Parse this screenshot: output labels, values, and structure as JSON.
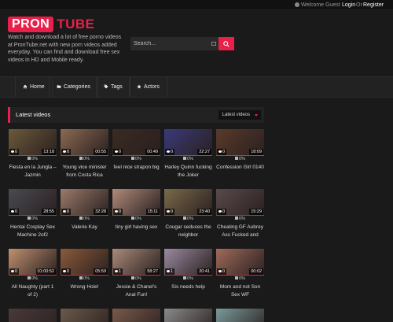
{
  "topbar": {
    "welcome": "Welcome Guest",
    "login": "Login",
    "or": "Or",
    "register": "Register"
  },
  "logo": {
    "part1": "PRON",
    "part2": "TUBE"
  },
  "tagline": "Watch and download a lot of free porno videos at PronTube.net with new porn videos added everyday. You can find and download free sex videos in HD and Mobile ready.",
  "search": {
    "placeholder": "Search..."
  },
  "nav": [
    {
      "label": "Home",
      "icon": "home-icon"
    },
    {
      "label": "Categories",
      "icon": "folder-icon"
    },
    {
      "label": "Tags",
      "icon": "tag-icon"
    },
    {
      "label": "Actors",
      "icon": "star-icon"
    }
  ],
  "section": {
    "title": "Latest videos",
    "filter": "Latest videos"
  },
  "videos": [
    {
      "title": "Fiesta en la Jungla – Jazmin",
      "views": "0",
      "duration": "13:18",
      "rating": "0%",
      "color": "#6b5a3a"
    },
    {
      "title": "Young vice minister from Costa Rica",
      "views": "0",
      "duration": "00:55",
      "rating": "0%",
      "color": "#8a6a52"
    },
    {
      "title": "feel nice strapon big",
      "views": "0",
      "duration": "00:49",
      "rating": "0%",
      "color": "#3a2a22"
    },
    {
      "title": "Harley Quinn fucking the Joker",
      "views": "0",
      "duration": "22:27",
      "rating": "0%",
      "color": "#3a3a7a"
    },
    {
      "title": "Confession Girl 0140",
      "views": "0",
      "duration": "18:09",
      "rating": "0%",
      "color": "#5a3a2a"
    },
    {
      "title": "Hentai Cosplay Sex Machine 2of2",
      "views": "0",
      "duration": "28:55",
      "rating": "0%",
      "color": "#4a4a52"
    },
    {
      "title": "Valerie Kay",
      "views": "0",
      "duration": "32:28",
      "rating": "0%",
      "color": "#9a7a6a"
    },
    {
      "title": "tiny girl having sex",
      "views": "0",
      "duration": "15:11",
      "rating": "0%",
      "color": "#b08a7a"
    },
    {
      "title": "Cougar seduces the neighbor",
      "views": "0",
      "duration": "23:40",
      "rating": "0%",
      "color": "#7a6a4a"
    },
    {
      "title": "Cheating GF Aubrey Ass Fucked and",
      "views": "0",
      "duration": "15:29",
      "rating": "0%",
      "color": "#5a4a4a"
    },
    {
      "title": "All Naughty (part 1 of 2)",
      "views": "0",
      "duration": "01:00:52",
      "rating": "0%",
      "color": "#c09070"
    },
    {
      "title": "Wrong Hole!",
      "views": "0",
      "duration": "05:59",
      "rating": "0%",
      "color": "#8a5a3a"
    },
    {
      "title": "Jessie & Chanel's Anal Fun!",
      "views": "1",
      "duration": "58:27",
      "rating": "0%",
      "color": "#aa8a7a"
    },
    {
      "title": "Sis needs help",
      "views": "1",
      "duration": "20:41",
      "rating": "0%",
      "color": "#9a8aa0"
    },
    {
      "title": "Mom and not Son Sex WF",
      "views": "0",
      "duration": "00:02",
      "rating": "0%",
      "color": "#a06a5a"
    },
    {
      "title": "",
      "views": "",
      "duration": "",
      "rating": "",
      "color": "#4a3a3a"
    },
    {
      "title": "",
      "views": "",
      "duration": "",
      "rating": "",
      "color": "#6a5a4a"
    },
    {
      "title": "",
      "views": "",
      "duration": "",
      "rating": "",
      "color": "#7a5a4a"
    },
    {
      "title": "",
      "views": "",
      "duration": "",
      "rating": "",
      "color": "#8a8a8a"
    },
    {
      "title": "",
      "views": "",
      "duration": "",
      "rating": "",
      "color": "#7a9a9a"
    }
  ]
}
